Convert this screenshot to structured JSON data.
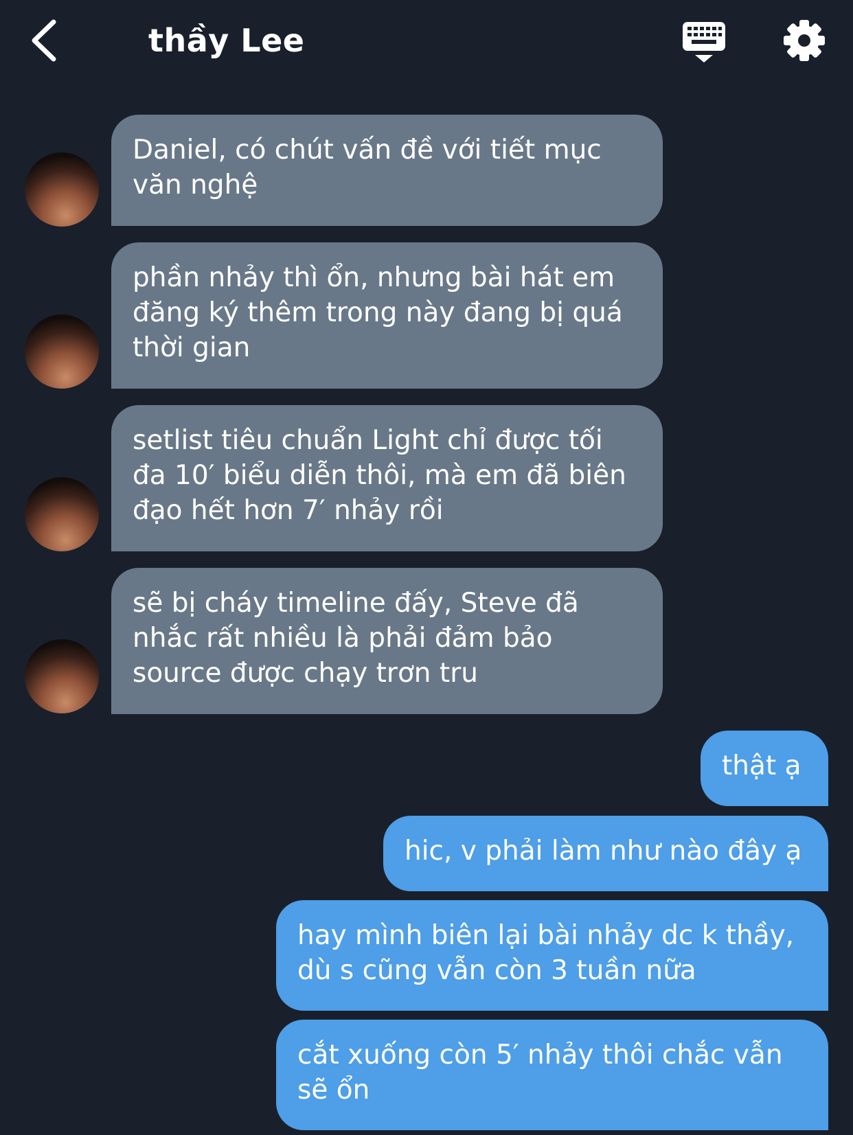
{
  "header": {
    "title": "thầy Lee",
    "back_icon": "chevron-left-icon",
    "keyboard_icon": "keyboard-icon",
    "settings_icon": "gear-icon"
  },
  "messages": [
    {
      "sender": "thầy Lee",
      "direction": "incoming",
      "text": "Daniel, có chút vấn đề với tiết mục\nvăn nghệ"
    },
    {
      "sender": "thầy Lee",
      "direction": "incoming",
      "text": "phần nhảy thì ổn, nhưng bài hát em\nđăng ký thêm trong này đang bị quá\nthời gian"
    },
    {
      "sender": "thầy Lee",
      "direction": "incoming",
      "text": "setlist tiêu chuẩn Light chỉ được tối\nđa 10′ biểu diễn thôi, mà em đã biên\nđạo hết hơn 7′ nhảy rồi"
    },
    {
      "sender": "thầy Lee",
      "direction": "incoming",
      "text": "sẽ bị cháy timeline đấy, Steve đã\nnhắc rất nhiều là phải đảm bảo\nsource được chạy trơn tru"
    },
    {
      "sender": "me",
      "direction": "outgoing",
      "text": "thật ạ"
    },
    {
      "sender": "me",
      "direction": "outgoing",
      "text": "hic, v phải làm như nào đây ạ"
    },
    {
      "sender": "me",
      "direction": "outgoing",
      "text": "hay mình biên lại bài nhảy dc k thầy,\ndù s cũng vẫn còn 3 tuần nữa"
    },
    {
      "sender": "me",
      "direction": "outgoing",
      "text": "cắt xuống còn 5′ nhảy thôi chắc vẫn\nsẽ ổn"
    }
  ],
  "colors": {
    "background": "#19202b",
    "incoming_bubble": "#697888",
    "outgoing_bubble": "#4e9ee8",
    "text": "#ffffff"
  }
}
